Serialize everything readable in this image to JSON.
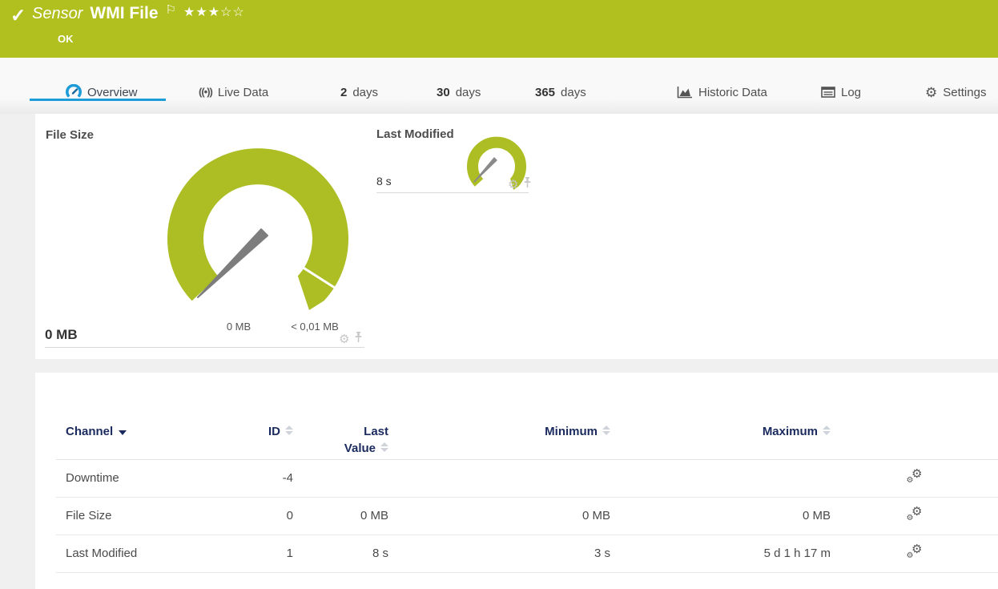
{
  "header": {
    "check_icon": "✓",
    "kind": "Sensor",
    "title": "WMI File",
    "flag_icon": "⚐",
    "stars": "★★★☆☆",
    "status": "OK"
  },
  "tabs": {
    "overview": "Overview",
    "live_data": "Live Data",
    "live_icon_glyph": "((•))",
    "d2_num": "2",
    "d2_label": "days",
    "d30_num": "30",
    "d30_label": "days",
    "d365_num": "365",
    "d365_label": "days",
    "historic": "Historic Data",
    "log": "Log",
    "settings": "Settings",
    "settings_icon_glyph": "⚙"
  },
  "file_size_widget": {
    "title": "File Size",
    "value": "0 MB",
    "gauge_min_label": "0 MB",
    "gauge_max_label": "< 0,01 MB",
    "gear_icon_glyph": "⚙"
  },
  "last_modified_widget": {
    "title": "Last Modified",
    "value": "8 s",
    "gear_icon_glyph": "⚙"
  },
  "gauge_data": {
    "file_size": {
      "min": "0 MB",
      "max": "< 0,01 MB",
      "current": "0 MB",
      "needle_at": "min"
    },
    "last_modified": {
      "current": "8 s",
      "needle_at": "low"
    }
  },
  "channels_table": {
    "columns": {
      "channel": "Channel",
      "id": "ID",
      "last_line1": "Last",
      "last_line2": "Value",
      "minimum": "Minimum",
      "maximum": "Maximum"
    },
    "rows": [
      {
        "channel": "Downtime",
        "id": "-4",
        "last_value": "",
        "minimum": "",
        "maximum": ""
      },
      {
        "channel": "File Size",
        "id": "0",
        "last_value": "0 MB",
        "minimum": "0 MB",
        "maximum": "0 MB"
      },
      {
        "channel": "Last Modified",
        "id": "1",
        "last_value": "8 s",
        "minimum": "3 s",
        "maximum": "5 d 1 h 17 m"
      }
    ],
    "row_gear_glyphs": {
      "big": "⚙",
      "small": "⚙"
    }
  },
  "colors": {
    "brand_green": "#b1c01e",
    "gauge_green": "#adbe25",
    "accent_blue": "#1e9cd8",
    "table_header_navy": "#1a2a5e",
    "needle_gray": "#7d7d7d"
  }
}
